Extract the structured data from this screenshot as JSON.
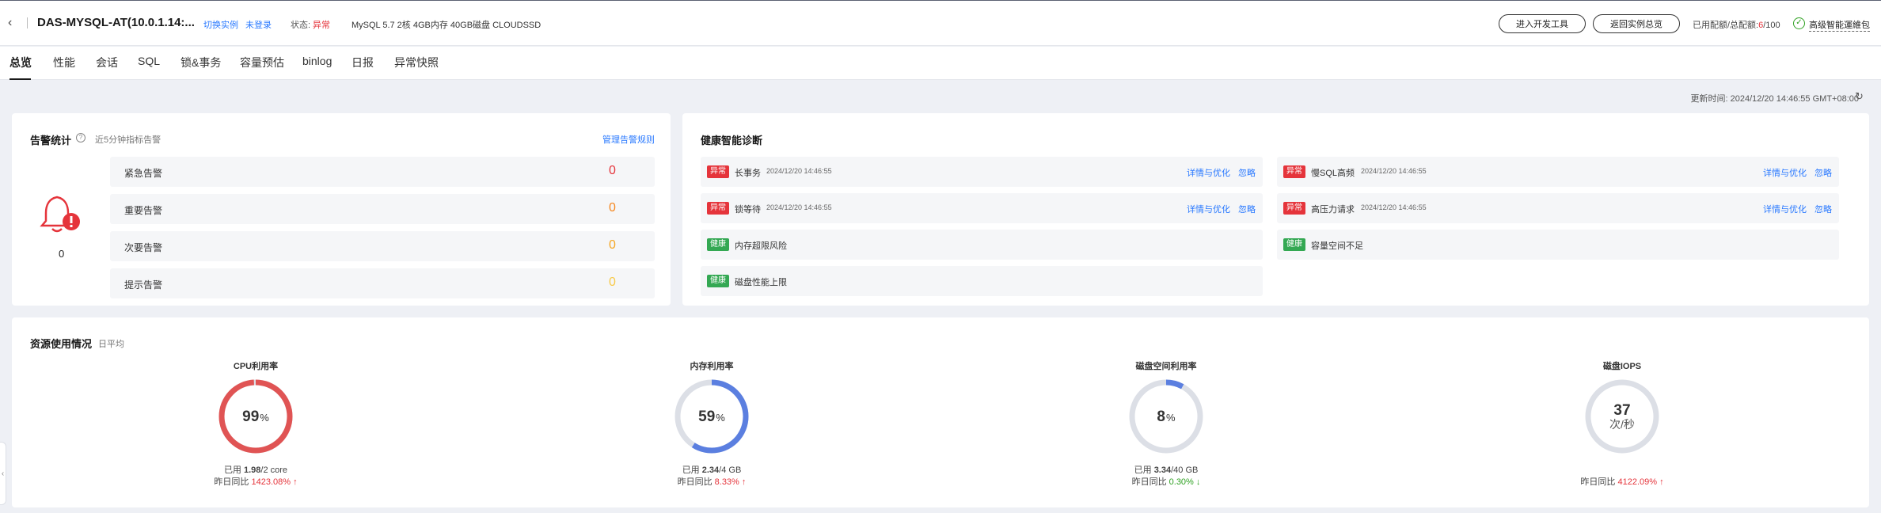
{
  "header": {
    "instance_name": "DAS-MYSQL-AT(10.0.1.14:...",
    "switch_label": "切换实例",
    "login_label": "未登录",
    "status_label": "状态:",
    "status_value": "异常",
    "spec": "MySQL 5.7 2核 4GB内存 40GB磁盘 CLOUDSSD",
    "dev_tools_button": "进入开发工具",
    "back_to_list_button": "返回实例总览",
    "quota_label": "已用配额/总配额:",
    "quota_used": "6",
    "quota_total": "/100",
    "advanced_link": "高级智能運維包"
  },
  "tabs": [
    "总览",
    "性能",
    "会话",
    "SQL",
    "锁&事务",
    "容量预估",
    "binlog",
    "日报",
    "异常快照"
  ],
  "update_time": "更新时间:   2024/12/20 14:46:55 GMT+08:00",
  "alerts": {
    "title": "告警统计",
    "subtitle": "近5分钟指标告警",
    "manage_link": "管理告警规则",
    "total": "0",
    "rows": [
      {
        "label": "紧急告警",
        "value": "0",
        "color": "#e5343b"
      },
      {
        "label": "重要告警",
        "value": "0",
        "color": "#f5871f"
      },
      {
        "label": "次要告警",
        "value": "0",
        "color": "#f5a623"
      },
      {
        "label": "提示告警",
        "value": "0",
        "color": "#f7c948"
      }
    ]
  },
  "diagnosis": {
    "title": "健康智能诊断",
    "detail_label": "详情与优化",
    "ignore_label": "忽略",
    "items": [
      {
        "status": "异常",
        "name": "长事务",
        "time": "2024/12/20 14:46:55"
      },
      {
        "status": "异常",
        "name": "慢SQL高频",
        "time": "2024/12/20 14:46:55"
      },
      {
        "status": "异常",
        "name": "锁等待",
        "time": "2024/12/20 14:46:55"
      },
      {
        "status": "异常",
        "name": "高压力请求",
        "time": "2024/12/20 14:46:55"
      },
      {
        "status": "健康",
        "name": "内存超限风险"
      },
      {
        "status": "健康",
        "name": "容量空间不足"
      },
      {
        "status": "健康",
        "name": "磁盘性能上限"
      }
    ]
  },
  "resources": {
    "title": "资源使用情况",
    "subtitle": "日平均",
    "gauges": [
      {
        "title": "CPU利用率",
        "value": "99",
        "unit": "%",
        "percent": 99,
        "color": "#e05454",
        "used_prefix": "已用 ",
        "used_value": "1.98",
        "used_suffix": "/2 core",
        "compare_label": "昨日同比 ",
        "compare_value": "1423.08%",
        "trend": "up"
      },
      {
        "title": "内存利用率",
        "value": "59",
        "unit": "%",
        "percent": 59,
        "color": "#5b7fe0",
        "used_prefix": "已用 ",
        "used_value": "2.34",
        "used_suffix": "/4 GB",
        "compare_label": "昨日同比 ",
        "compare_value": "8.33%",
        "trend": "up"
      },
      {
        "title": "磁盘空间利用率",
        "value": "8",
        "unit": "%",
        "percent": 8,
        "color": "#5b7fe0",
        "used_prefix": "已用 ",
        "used_value": "3.34",
        "used_suffix": "/40 GB",
        "compare_label": "昨日同比 ",
        "compare_value": "0.30%",
        "trend": "down"
      },
      {
        "title": "磁盘IOPS",
        "value": "37",
        "unit": "次/秒",
        "percent": 0,
        "color": "#5b7fe0",
        "compare_label": "昨日同比 ",
        "compare_value": "4122.09%",
        "trend": "up"
      }
    ]
  }
}
